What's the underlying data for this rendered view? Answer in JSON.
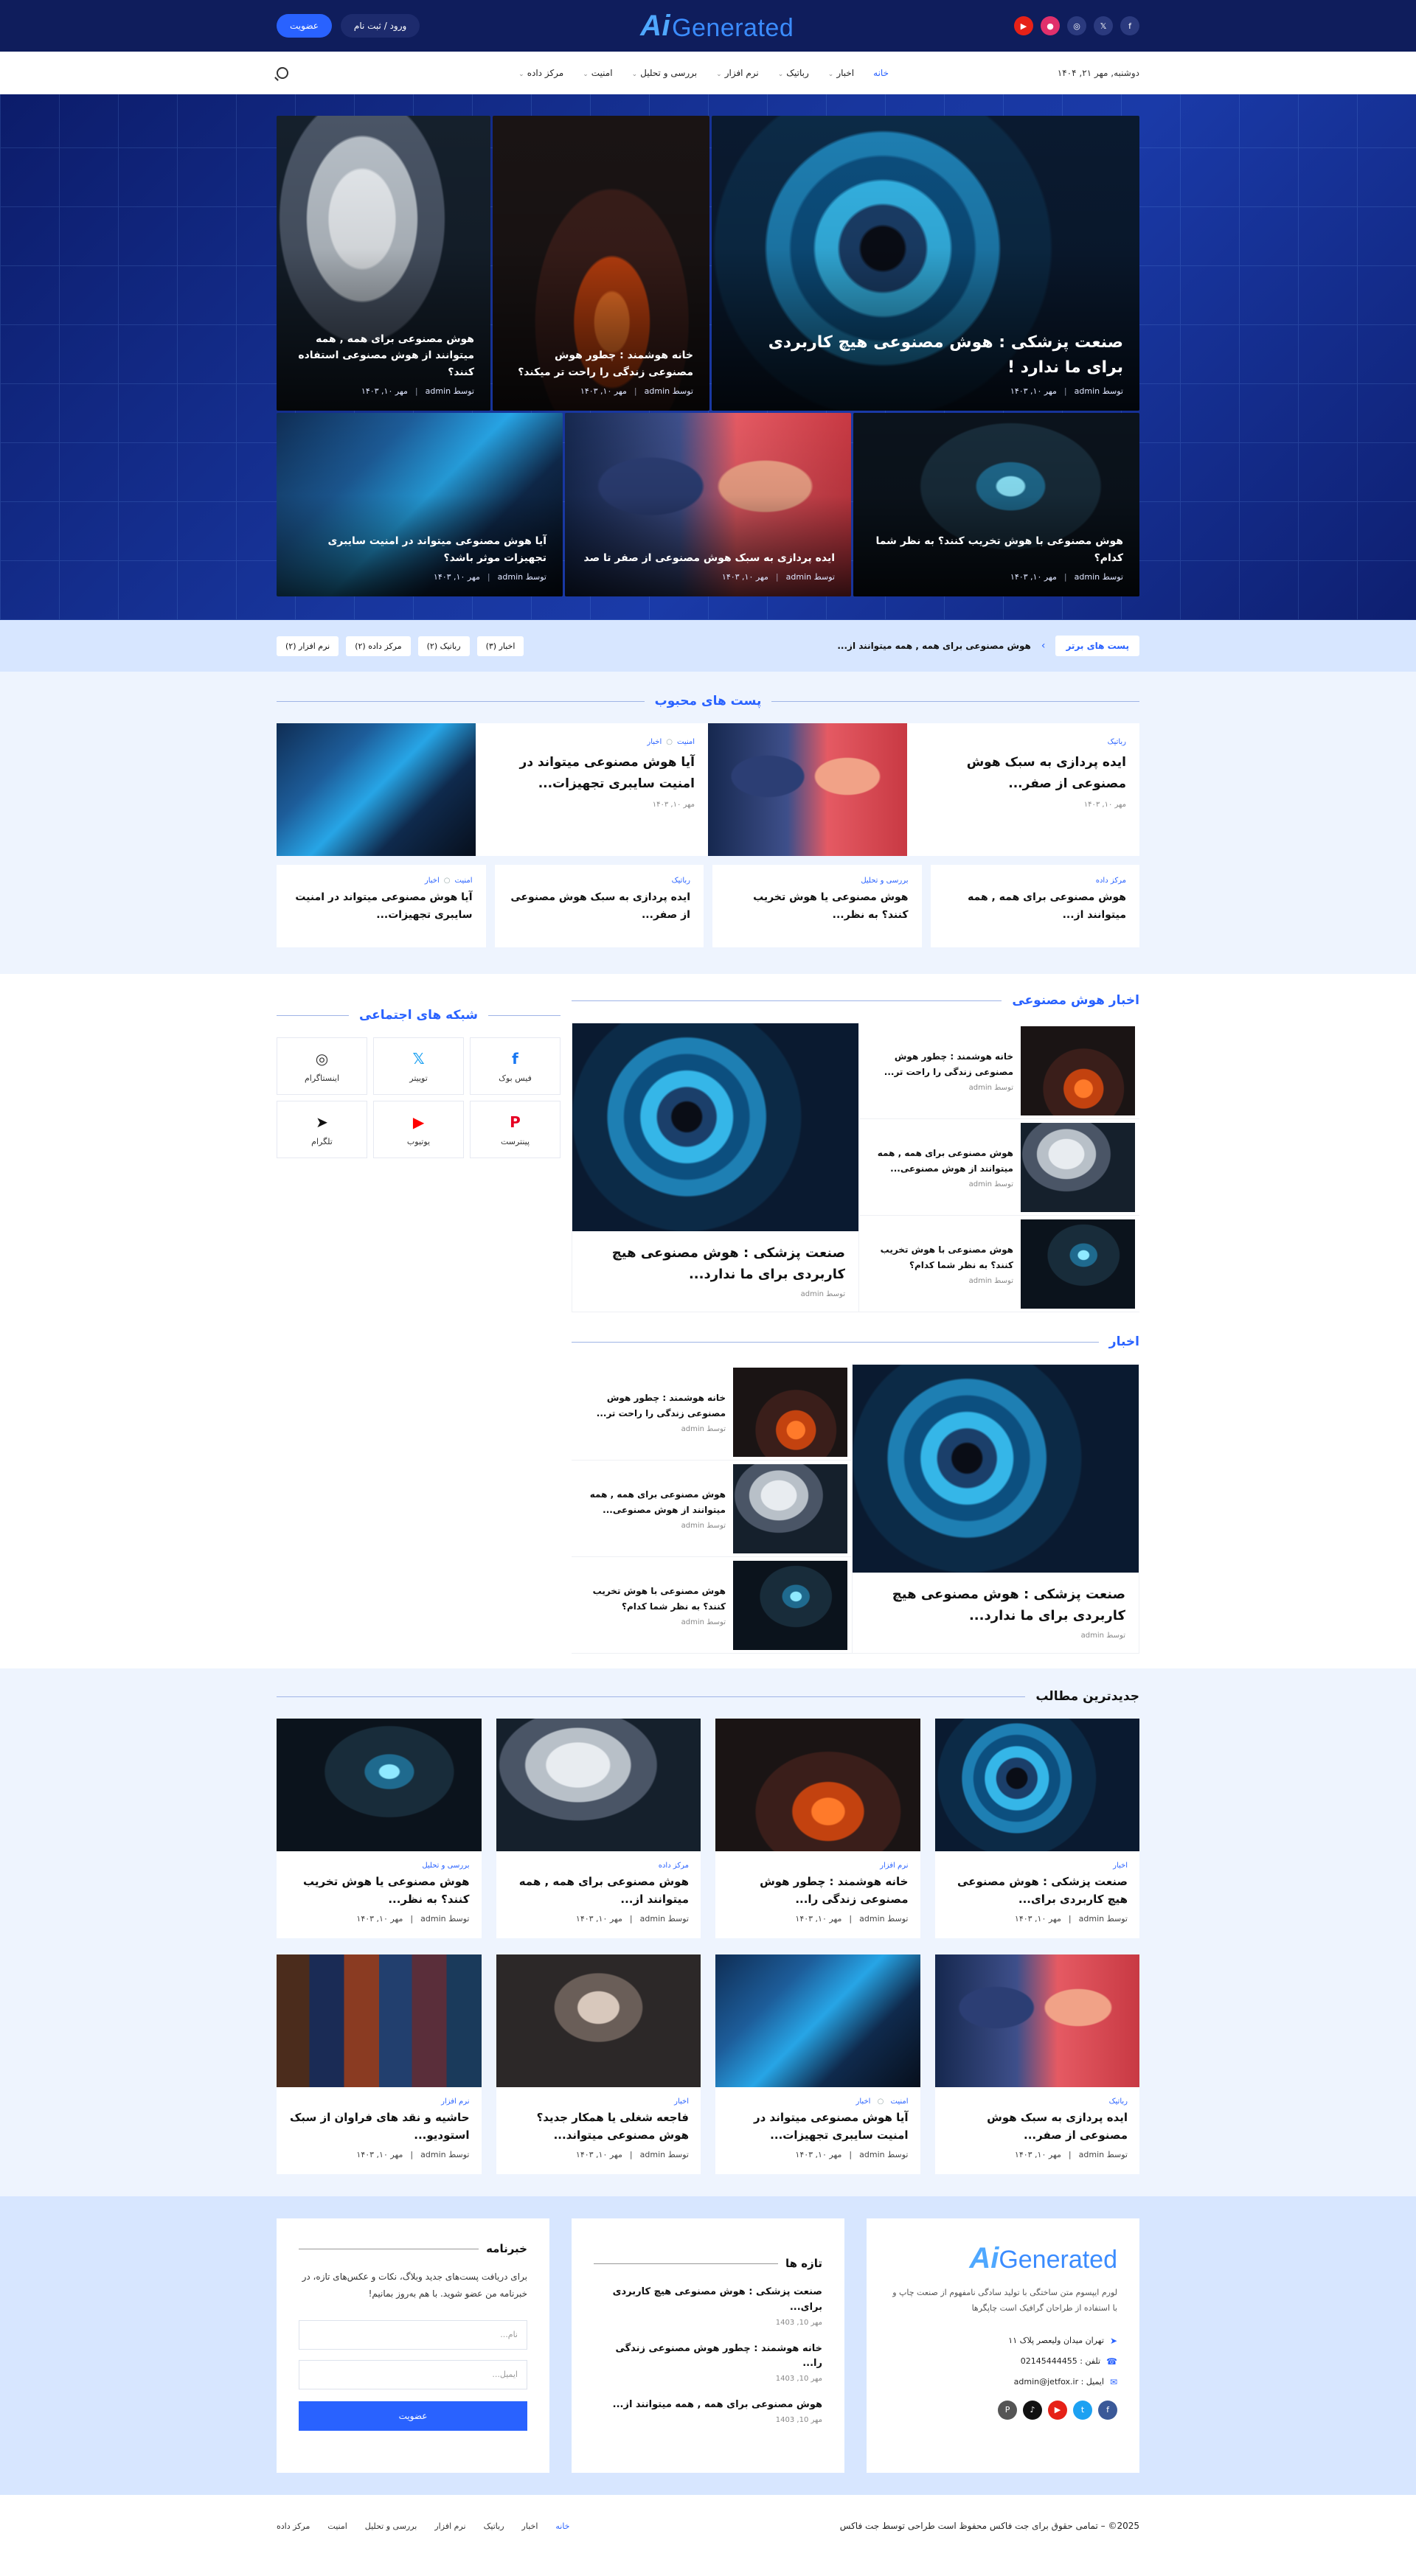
{
  "topbar": {
    "logo": "Generated",
    "logo_mark": "Ai",
    "login": "ورود / ثبت نام",
    "join": "عضویت",
    "social": [
      "f",
      "𝕏",
      "◎",
      "●",
      "▶"
    ]
  },
  "nav": {
    "date": "دوشنبه, مهر ۲۱, ۱۴۰۴",
    "items": [
      "خانه",
      "اخبار",
      "رباتیک",
      "نرم افزار",
      "بررسی و تحلیل",
      "امنیت",
      "مرکز داده"
    ]
  },
  "hero": {
    "big": {
      "title": "صنعت پزشکی : هوش مصنوعی هیچ کاربردی برای ما ندارد !",
      "author": "توسط admin",
      "date": "مهر ۱۰, ۱۴۰۳"
    },
    "mid": {
      "title": "خانه هوشمند : چطور هوش مصنوعی زندگی را راحت تر میکند؟",
      "author": "توسط admin",
      "date": "مهر ۱۰, ۱۴۰۳"
    },
    "left": {
      "title": "هوش مصنوعی برای همه , همه میتوانند از هوش مصنوعی استفاده کنند؟",
      "author": "توسط admin",
      "date": "مهر ۱۰, ۱۴۰۳"
    },
    "b1": {
      "title": "هوش مصنوعی با هوش تخریب کنند؟ به نظر شما کدام؟",
      "author": "توسط admin",
      "date": "مهر ۱۰, ۱۴۰۳"
    },
    "b2": {
      "title": "ایده پردازی به سبک هوش مصنوعی از صفر تا صد",
      "author": "توسط admin",
      "date": "مهر ۱۰, ۱۴۰۳"
    },
    "b3": {
      "title": "آیا هوش مصنوعی میتواند در امنیت سایبری تجهیزات موثر باشد؟",
      "author": "توسط admin",
      "date": "مهر ۱۰, ۱۴۰۳"
    }
  },
  "ticker": {
    "badge": "پست های برتر",
    "text": "هوش مصنوعی برای همه , همه میتوانند از...",
    "tags": [
      "اخبار (۳)",
      "رباتیک (۲)",
      "مرکز داده (۲)",
      "نرم افزار (۲)"
    ]
  },
  "popular": {
    "heading": "پست های محبوب",
    "top": [
      {
        "cat": "رباتیک",
        "cat2": "",
        "title": "ایده پردازی به سبک هوش مصنوعی از صفر...",
        "date": "مهر ۱۰, ۱۴۰۳"
      },
      {
        "cat": "امنیت",
        "cat2": "اخبار",
        "title": "آیا هوش مصنوعی میتواند در امنیت سایبری تجهیزات...",
        "date": "مهر ۱۰, ۱۴۰۳"
      }
    ],
    "bottom": [
      {
        "cat": "مرکز داده",
        "cat2": "",
        "title": "هوش مصنوعی برای همه , همه میتوانند از..."
      },
      {
        "cat": "بررسی و تحلیل",
        "cat2": "",
        "title": "هوش مصنوعی یا هوش تخریب کنند؟ به نظر..."
      },
      {
        "cat": "رباتیک",
        "cat2": "",
        "title": "ایده پردازی به سبک هوش مصنوعی از صفر..."
      },
      {
        "cat": "امنیت",
        "cat2": "اخبار",
        "title": "آیا هوش مصنوعی میتواند در امنیت سایبری تجهیزات..."
      }
    ]
  },
  "ai_news": {
    "heading": "اخبار هوش مصنوعی",
    "big": {
      "title": "صنعت پزشکی : هوش مصنوعی هیچ کاربردی برای ما ندارد...",
      "author": "توسط admin"
    },
    "items": [
      {
        "title": "خانه هوشمند : چطور هوش مصنوعی زندگی را راحت تر...",
        "author": "توسط admin"
      },
      {
        "title": "هوش مصنوعی برای همه , همه میتوانند از هوش مصنوعی...",
        "author": "توسط admin"
      },
      {
        "title": "هوش مصنوعی با هوش تخریب کنند؟ به نظر شما کدام؟",
        "author": "توسط admin"
      }
    ]
  },
  "news": {
    "heading": "اخبار",
    "big": {
      "title": "صنعت پزشکی : هوش مصنوعی هیچ کاربردی برای ما ندارد...",
      "author": "توسط admin"
    },
    "items": [
      {
        "title": "خانه هوشمند : چطور هوش مصنوعی زندگی را راحت تر...",
        "author": "توسط admin"
      },
      {
        "title": "هوش مصنوعی برای همه , همه میتوانند از هوش مصنوعی...",
        "author": "توسط admin"
      },
      {
        "title": "هوش مصنوعی با هوش تخریب کنند؟ به نظر شما کدام؟",
        "author": "توسط admin"
      }
    ]
  },
  "social": {
    "heading": "شبکه های اجتماعی",
    "items": [
      {
        "label": "فیس بوک",
        "icon": "f",
        "color": "#1877f2"
      },
      {
        "label": "توییتر",
        "icon": "𝕏",
        "color": "#1da1f2"
      },
      {
        "label": "اینستاگرام",
        "icon": "◎",
        "color": "#333"
      },
      {
        "label": "پینترست",
        "icon": "P",
        "color": "#e60023"
      },
      {
        "label": "یوتیوب",
        "icon": "▶",
        "color": "#ff0000"
      },
      {
        "label": "تلگرام",
        "icon": "➤",
        "color": "#111"
      }
    ]
  },
  "latest": {
    "heading": "جدیدترین مطالب",
    "items": [
      {
        "cat": "اخبار",
        "cat2": "",
        "title": "صنعت پزشکی : هوش مصنوعی هیچ کاربردی برای...",
        "author": "توسط admin",
        "date": "مهر ۱۰, ۱۴۰۳"
      },
      {
        "cat": "نرم افزار",
        "cat2": "",
        "title": "خانه هوشمند : چطور هوش مصنوعی زندگی را...",
        "author": "توسط admin",
        "date": "مهر ۱۰, ۱۴۰۳"
      },
      {
        "cat": "مرکز داده",
        "cat2": "",
        "title": "هوش مصنوعی برای همه , همه میتوانند از...",
        "author": "توسط admin",
        "date": "مهر ۱۰, ۱۴۰۳"
      },
      {
        "cat": "بررسی و تحلیل",
        "cat2": "",
        "title": "هوش مصنوعی یا هوش تخریب کنند؟ به نظر...",
        "author": "توسط admin",
        "date": "مهر ۱۰, ۱۴۰۳"
      },
      {
        "cat": "رباتیک",
        "cat2": "",
        "title": "ایده پردازی به سبک هوش مصنوعی از صفر...",
        "author": "توسط admin",
        "date": "مهر ۱۰, ۱۴۰۳"
      },
      {
        "cat": "امنیت",
        "cat2": "اخبار",
        "title": "آیا هوش مصنوعی میتواند در امنیت سایبری تجهیزات...",
        "author": "توسط admin",
        "date": "مهر ۱۰, ۱۴۰۳"
      },
      {
        "cat": "اخبار",
        "cat2": "",
        "title": "فاجعه شغلی یا همکار جدید؟ هوش مصنوعی میتواند...",
        "author": "توسط admin",
        "date": "مهر ۱۰, ۱۴۰۳"
      },
      {
        "cat": "نرم افزار",
        "cat2": "",
        "title": "حاشیه و نقد های فراوان از سبک استودیو...",
        "author": "توسط admin",
        "date": "مهر ۱۰, ۱۴۰۳"
      }
    ]
  },
  "footer": {
    "desc": "لورم ایپسوم متن ساختگی با تولید سادگی نامفهوم از صنعت چاپ و با استفاده از طراحان گرافیک است چاپگرها",
    "address": "تهران میدان ولیعصر پلاک ۱۱",
    "phone": "تلفن : 02145444455",
    "email": "ایمیل : admin@jetfox.ir",
    "fresh_heading": "تازه ها",
    "fresh": [
      {
        "title": "صنعت پزشکی : هوش مصنوعی هیچ کاربردی برای...",
        "date": "مهر 10, 1403"
      },
      {
        "title": "خانه هوشمند : چطور هوش مصنوعی زندگی را...",
        "date": "مهر 10, 1403"
      },
      {
        "title": "هوش مصنوعی برای همه , همه میتوانند از...",
        "date": "مهر 10, 1403"
      }
    ],
    "nl_heading": "خبرنامه",
    "nl_desc": "برای دریافت پست‌های جدید وبلاگ، نکات و عکس‌های تازه، در خبرنامه من عضو شوید. با هم بەروز بمانیم!",
    "nl_name": "نام...",
    "nl_email": "ایمیل...",
    "nl_btn": "عضویت",
    "copyright": "2025© – تمامی حقوق برای جت فاکس محفوظ است طراحی توسط جت فاکس",
    "links": [
      "خانه",
      "اخبار",
      "رباتیک",
      "نرم افزار",
      "بررسی و تحلیل",
      "امنیت",
      "مرکز داده"
    ]
  }
}
